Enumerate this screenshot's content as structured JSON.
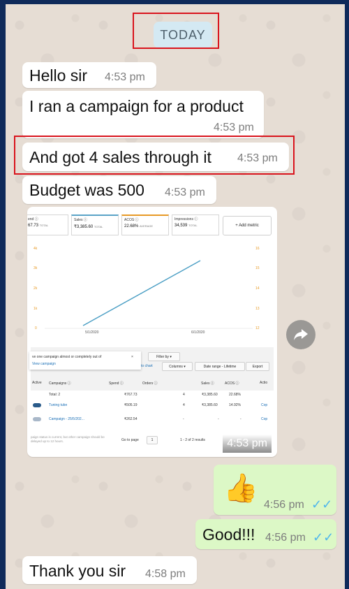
{
  "date_chip": "TODAY",
  "messages": [
    {
      "text": "Hello sir",
      "time": "4:53 pm"
    },
    {
      "text": "I ran a campaign for a product",
      "time": "4:53 pm"
    },
    {
      "text": "And got 4 sales through it",
      "time": "4:53 pm"
    },
    {
      "text": "Budget was 500",
      "time": "4:53 pm"
    },
    {
      "time": "4:53 pm"
    },
    {
      "emoji": "👍",
      "time": "4:56 pm",
      "ticks": "✓✓"
    },
    {
      "text": "Good!!!",
      "time": "4:56 pm",
      "ticks": "✓✓"
    },
    {
      "text": "Thank you sir",
      "time": "4:58 pm"
    }
  ],
  "screenshot": {
    "metrics": [
      {
        "label": "end ⓘ",
        "value": "67.73",
        "sub": "TOTAL"
      },
      {
        "label": "Sales ⓘ",
        "value": "₹3,385.60",
        "sub": "TOTAL"
      },
      {
        "label": "ACOS ⓘ",
        "value": "22.68%",
        "sub": "AVERAGE"
      },
      {
        "label": "Impressions ⓘ",
        "value": "34,539",
        "sub": "TOTAL"
      }
    ],
    "add_metric": "+ Add metric",
    "left_ticks": [
      "4k",
      "3k",
      "2k",
      "1k",
      "0"
    ],
    "right_ticks": [
      "16",
      "15",
      "14",
      "13",
      "12"
    ],
    "x_ticks": [
      "5/1/2020",
      "6/1/2020"
    ],
    "alert_text": "ve one campaign almost or completely out of",
    "alert_link": "View campaign",
    "filter_by": "Filter by ▾",
    "to_chart": "to chart",
    "columns": "Columns ▾",
    "date_range": "Date range - Lifetime",
    "export": "Export",
    "table_headers": [
      "Active",
      "Campaigns ⓘ",
      "Spend ⓘ",
      "Orders ⓘ",
      "Sales ⓘ",
      "ACOS ⓘ",
      "Actio"
    ],
    "total_row": {
      "name": "Total: 2",
      "spend": "₹767.73",
      "orders": "4",
      "sales": "₹3,385.60",
      "acos": "22.68%"
    },
    "rows": [
      {
        "name": "Tuning tube",
        "spend": "₹505.19",
        "orders": "4",
        "sales": "₹3,385.60",
        "acos": "14.92%",
        "action": "Cop"
      },
      {
        "name": "Campaign - 25/5/202...",
        "spend": "₹262.54",
        "orders": "-",
        "sales": "-",
        "acos": "-",
        "action": "Cop"
      }
    ],
    "footer_note": "paign status is current, but other campaign should be delayed up to 12 hours.",
    "go_to_page": "Go to page",
    "page_value": "1",
    "results": "1 - 2 of 2 results"
  },
  "colors": {
    "page_bg": "#0f2a5a",
    "chat_bg": "#e6ddd4",
    "incoming": "#ffffff",
    "outgoing": "#dcf8c6",
    "date_chip": "#d4e9f3",
    "highlight": "#d9141d",
    "read_ticks": "#4fb6ec"
  }
}
